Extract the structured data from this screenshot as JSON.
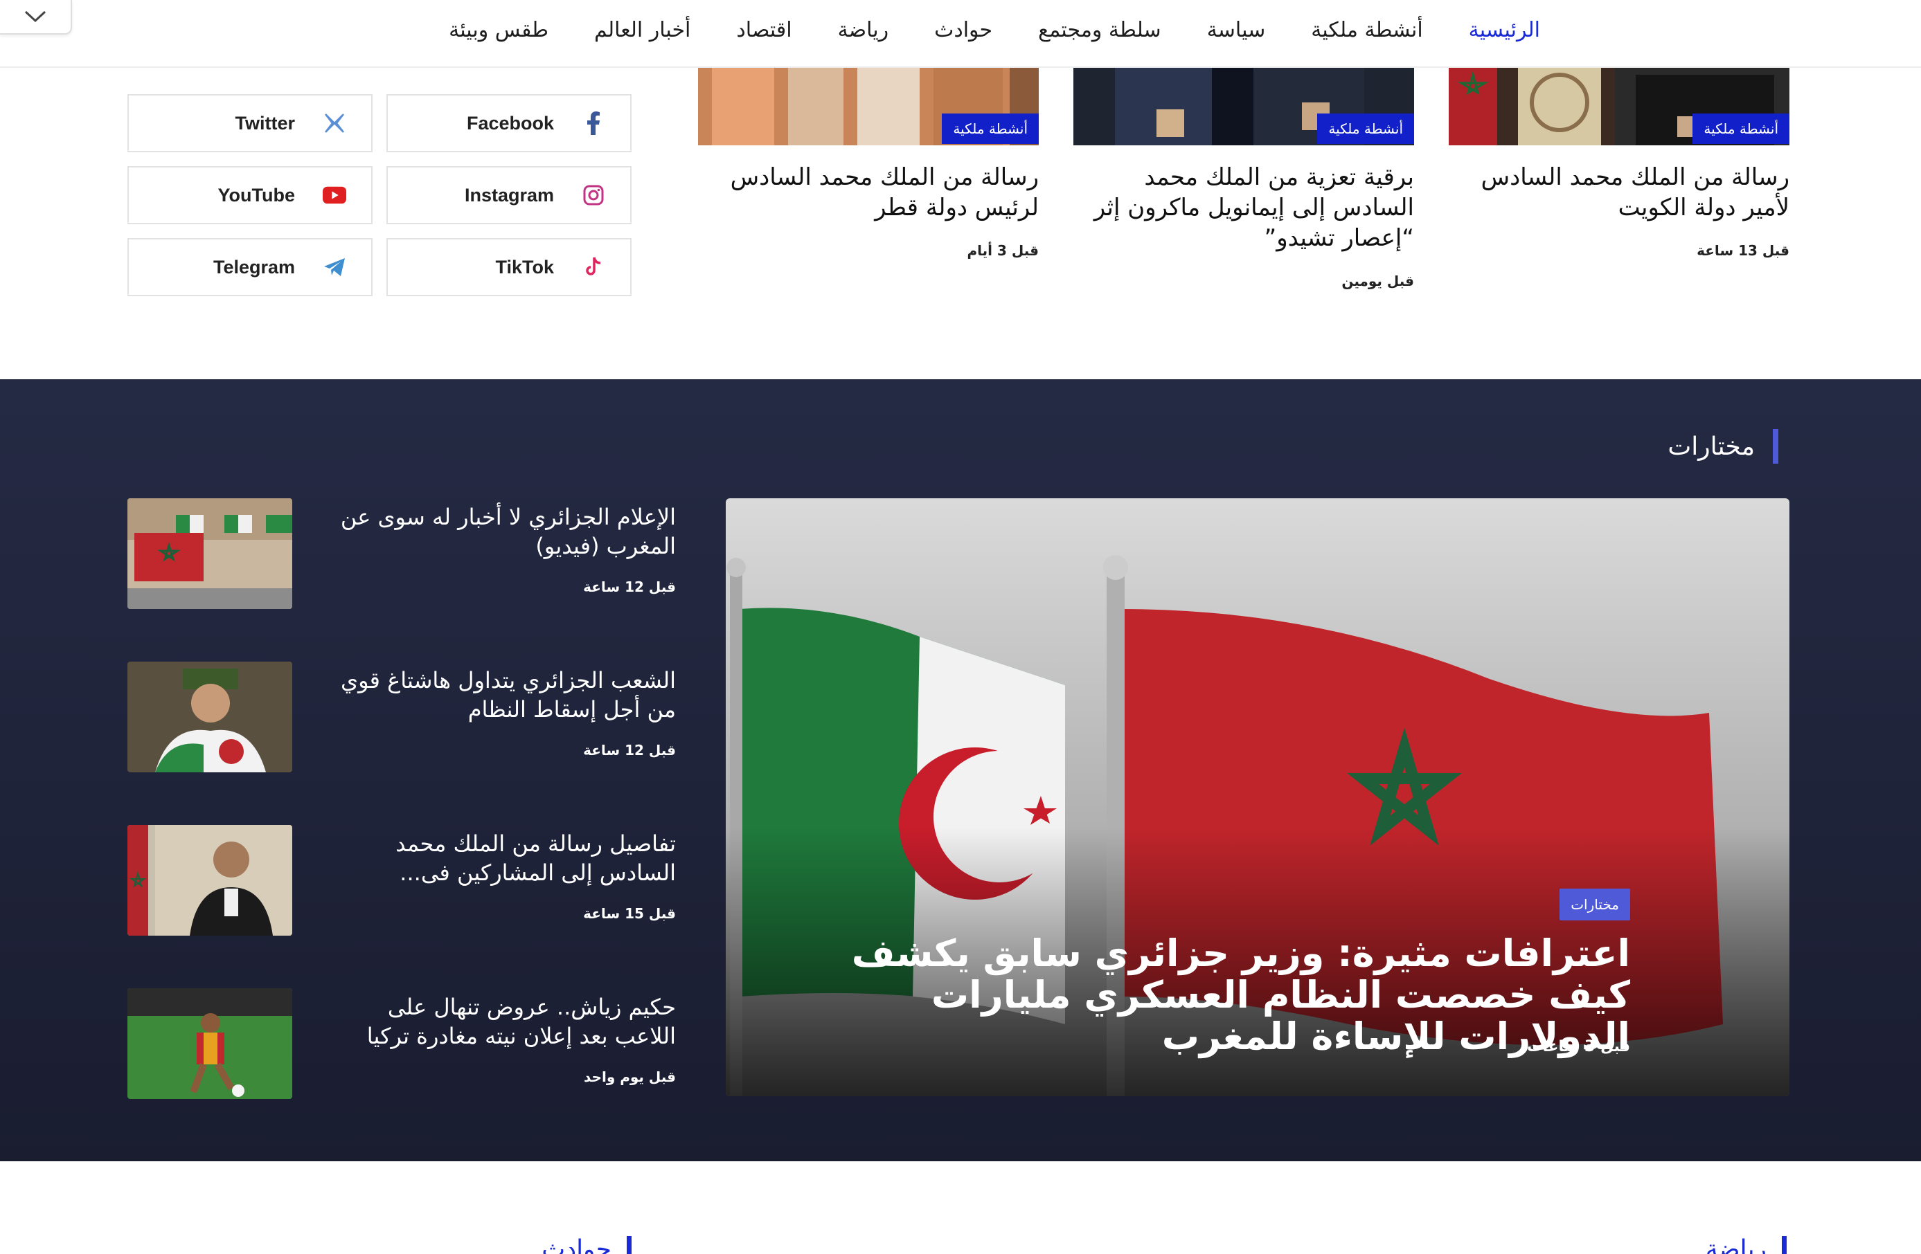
{
  "nav": {
    "items": [
      "الرئيسية",
      "أنشطة ملكية",
      "سياسة",
      "سلطة ومجتمع",
      "حوادث",
      "رياضة",
      "اقتصاد",
      "أخبار العالم",
      "طقس وبيئة"
    ],
    "active_index": 0
  },
  "social": {
    "facebook": "Facebook",
    "twitter": "Twitter",
    "instagram": "Instagram",
    "youtube": "YouTube",
    "tiktok": "TikTok",
    "telegram": "Telegram"
  },
  "top_cards": [
    {
      "badge": "أنشطة ملكية",
      "title": "رسالة من الملك محمد السادس لأمير دولة الكويت",
      "time": "قبل 13 ساعة"
    },
    {
      "badge": "أنشطة ملكية",
      "title": "برقية تعزية من الملك محمد السادس إلى إيمانويل ماكرون إثر “إعصار تشيدو”",
      "time": "قبل يومين"
    },
    {
      "badge": "أنشطة ملكية",
      "title": "رسالة من الملك محمد السادس لرئيس دولة قطر",
      "time": "قبل 3 أيام"
    }
  ],
  "featured": {
    "section_title": "مختارات",
    "hero": {
      "category": "مختارات",
      "headline": "اعترافات مثيرة: وزير جزائري سابق يكشف كيف خصصت النظام العسكري مليارات الدولارات للإساءة للمغرب",
      "time": "قبل 3 ساعات"
    },
    "side_items": [
      {
        "title": "الإعلام الجزائري لا أخبار له سوى عن المغرب (فيديو)",
        "time": "قبل 12 ساعة"
      },
      {
        "title": "الشعب الجزائري يتداول هاشتاغ قوي من أجل إسقاط النظام",
        "time": "قبل 12 ساعة"
      },
      {
        "title": "تفاصيل رسالة من الملك محمد السادس إلى المشاركين فى...",
        "time": "قبل 15 ساعة"
      },
      {
        "title": "حكيم زياش.. عروض تنهال على اللاعب بعد إعلان نيته مغادرة تركيا",
        "time": "قبل يوم واحد"
      }
    ]
  },
  "bottom_sections": {
    "right": "رياضة",
    "left": "حوادث"
  },
  "colors": {
    "accent": "#1a2bd6",
    "badge": "#1220c9",
    "featured_bg": "#1f2338",
    "featured_accent": "#4e5ad8"
  }
}
